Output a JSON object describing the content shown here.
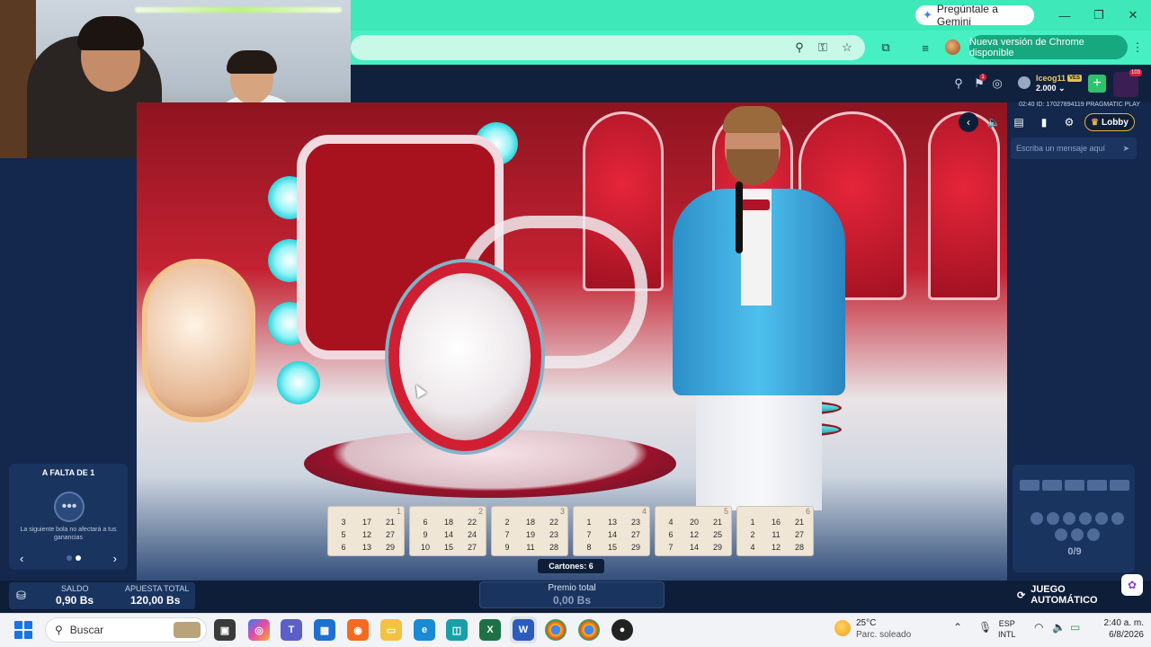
{
  "browser": {
    "gemini_button": "Pregúntale a Gemini",
    "update_pill": "Nueva versión de Chrome disponible",
    "icons": [
      "zoom-icon",
      "password-key-icon",
      "bookmark-star-icon",
      "extensions-icon",
      "media-queue-icon",
      "profile-avatar",
      "more-menu-icon"
    ]
  },
  "game_header": {
    "username": "Iceog11",
    "vip_label": "VES",
    "balance": "2.000",
    "notifications_count": "1",
    "level_badge_count": "103",
    "round_info": "02:40 ID: 17027894119 PRAGMATIC PLAY",
    "lobby_label": "Lobby",
    "chat_placeholder": "Escriba un mensaje aquí"
  },
  "left_widget": {
    "title": "A FALTA DE 1",
    "note": "La siguiente bola no afectará a tus ganancias"
  },
  "cards": [
    {
      "number": "1",
      "rows": [
        [
          "3",
          "17",
          "21"
        ],
        [
          "5",
          "12",
          "27"
        ],
        [
          "6",
          "13",
          "29"
        ]
      ]
    },
    {
      "number": "2",
      "rows": [
        [
          "6",
          "18",
          "22"
        ],
        [
          "9",
          "14",
          "24"
        ],
        [
          "10",
          "15",
          "27"
        ]
      ]
    },
    {
      "number": "3",
      "rows": [
        [
          "2",
          "18",
          "22"
        ],
        [
          "7",
          "19",
          "23"
        ],
        [
          "9",
          "11",
          "28"
        ]
      ]
    },
    {
      "number": "4",
      "rows": [
        [
          "1",
          "13",
          "23"
        ],
        [
          "7",
          "14",
          "27"
        ],
        [
          "8",
          "15",
          "29"
        ]
      ]
    },
    {
      "number": "5",
      "rows": [
        [
          "4",
          "20",
          "21"
        ],
        [
          "6",
          "12",
          "25"
        ],
        [
          "7",
          "14",
          "29"
        ]
      ]
    },
    {
      "number": "6",
      "rows": [
        [
          "1",
          "16",
          "21"
        ],
        [
          "2",
          "11",
          "27"
        ],
        [
          "4",
          "12",
          "28"
        ]
      ]
    }
  ],
  "cartones_label": "Cartones: 6",
  "ball_counter": "0/9",
  "bottom_bar": {
    "saldo_label": "SALDO",
    "saldo_value": "0,90 Bs",
    "apuesta_label": "APUESTA TOTAL",
    "apuesta_value": "120,00 Bs",
    "premio_label": "Premio total",
    "premio_value": "0,00 Bs",
    "auto_label": "JUEGO AUTOMÁTICO"
  },
  "taskbar": {
    "search_placeholder": "Buscar",
    "weather_temp": "25°C",
    "weather_desc": "Parc. soleado",
    "lang_line1": "ESP",
    "lang_line2": "INTL",
    "time": "2:40 a. m.",
    "date": "6/8/2026",
    "apps": [
      "task-view",
      "copilot",
      "teams",
      "store",
      "firefox",
      "file-explorer",
      "edge",
      "app-teal",
      "excel",
      "word",
      "chrome",
      "chrome-profile",
      "chrome-extra"
    ]
  },
  "colors": {
    "chrome_accent": "#46f0c2",
    "game_panel": "#13284c",
    "stage_red": "#c42232",
    "lobby_border": "#e0b24a"
  }
}
